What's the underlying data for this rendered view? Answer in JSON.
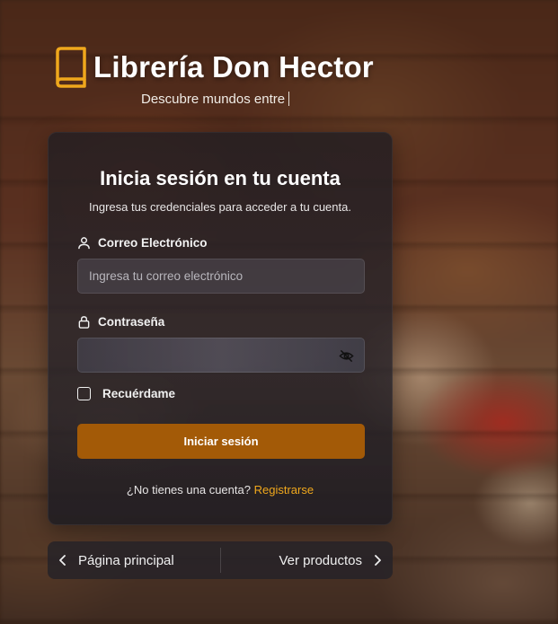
{
  "brand": {
    "title": "Librería Don Hector",
    "tagline": "Descubre mundos entre",
    "logo_icon": "book-icon",
    "accent_color": "#f0a81c"
  },
  "login_card": {
    "title": "Inicia sesión en tu cuenta",
    "subtitle": "Ingresa tus credenciales para acceder a tu cuenta.",
    "email": {
      "label": "Correo Electrónico",
      "icon": "user-icon",
      "placeholder": "Ingresa tu correo electrónico",
      "value": ""
    },
    "password": {
      "label": "Contraseña",
      "icon": "lock-icon",
      "toggle_icon": "eye-off-icon",
      "value": ""
    },
    "remember": {
      "label": "Recuérdame",
      "checked": false
    },
    "submit_label": "Iniciar sesión",
    "button_color": "#a35a07",
    "signup_prompt": "¿No tienes una cuenta?",
    "signup_link": "Registrarse"
  },
  "nav": {
    "home_label": "Página principal",
    "home_icon": "chevron-left-icon",
    "products_label": "Ver productos",
    "products_icon": "chevron-right-icon"
  }
}
